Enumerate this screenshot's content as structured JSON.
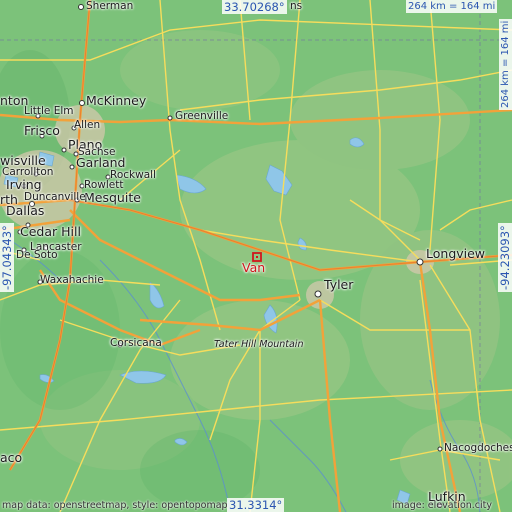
{
  "map": {
    "place": "Van",
    "coords": {
      "top": "33.70268°",
      "bottom": "31.3314°",
      "left": "-97.04343°",
      "right": "-94.23093°"
    },
    "scale": {
      "top": "264 km = 164 mi",
      "right": "264 km = 164 mi"
    },
    "attribution": {
      "left": "map data: openstreetmap, style: opentopomap",
      "right": "image: elevation.city"
    },
    "cities": [
      "Sherman",
      "McKinney",
      "Little Elm",
      "Frisco",
      "Allen",
      "Plano",
      "Sachse",
      "Garland",
      "Rockwall",
      "Rowlett",
      "Carrollton",
      "Irving",
      "Dallas",
      "Mesquite",
      "Cedar Hill",
      "Lancaster",
      "De Soto",
      "Duncanville",
      "Waxahachie",
      "Corsicana",
      "Greenville",
      "Van",
      "Tyler",
      "Longview",
      "Nacogdoches",
      "Lufkin",
      "aco",
      "nton",
      "wisville",
      "rth",
      "ns"
    ],
    "features": [
      "Tater Hill Mountain"
    ]
  },
  "colors": {
    "land_low": "#7cc27a",
    "land_high": "#b7c98a",
    "water": "#8fc6e8",
    "highway": "#f2a23a",
    "road": "#f6dd5c",
    "border": "#5c4e9a",
    "marker": "#d0161d"
  },
  "icons": {
    "marker": "red-square-marker-icon"
  }
}
